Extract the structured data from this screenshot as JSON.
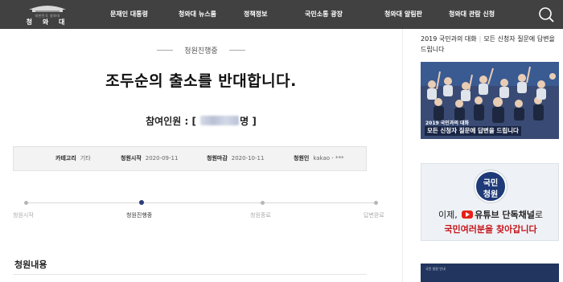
{
  "header": {
    "logo": {
      "small_text": "대한민국 청와대",
      "name": "청 와 대"
    },
    "menu": [
      "문재인 대통령",
      "청와대 뉴스룸",
      "정책정보",
      "국민소통 광장",
      "청와대 알림판",
      "청와대 관람 신청"
    ],
    "search_icon": "search-icon"
  },
  "petition": {
    "status": "청원진행중",
    "title": "조두순의 출소를 반대합니다.",
    "participants_prefix": "참여인원 : [",
    "participants_suffix": "명 ]",
    "info": {
      "category_label": "카테고리",
      "category_value": "기타",
      "start_label": "청원시작",
      "start_value": "2020-09-11",
      "end_label": "청원마감",
      "end_value": "2020-10-11",
      "author_label": "청원인",
      "author_value": "kakao - ***"
    },
    "steps": [
      "청원시작",
      "청원진행중",
      "청원종료",
      "답변완료"
    ],
    "active_step": 1,
    "content_heading": "청원내용"
  },
  "sidebar": {
    "notice_a": "2019 국민과의 대화",
    "notice_b": "모든 신청자 질문에 답변을 드립니다",
    "banner1_small": "2019 국민과의 대화",
    "banner1_caption": "모든 신청자 질문에 답변을 드립니다",
    "banner2": {
      "badge_line1": "국민",
      "badge_line2": "청원",
      "line1_a": "이제,",
      "line1_b": "유튜브 단독채널",
      "line1_c": "로",
      "line2": "국민여러분을 찾아갑니다"
    },
    "banner3_text": "국민 청원 안내"
  },
  "colors": {
    "nav_bg": "#414141",
    "accent": "#2a3f78",
    "youtube": "#e62117",
    "banner_red": "#c4161c"
  }
}
